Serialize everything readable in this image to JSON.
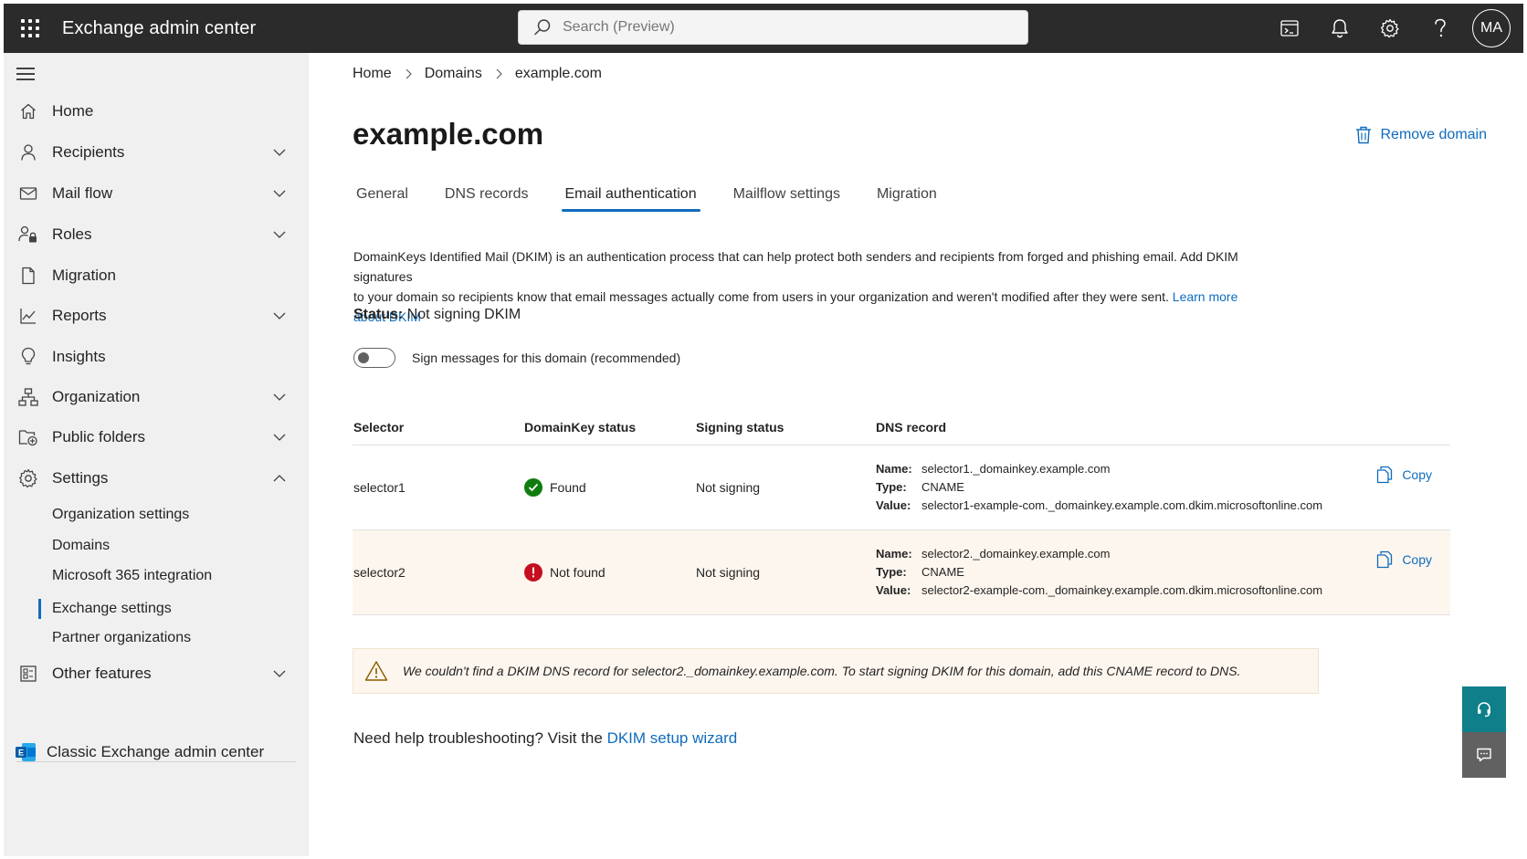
{
  "topbar": {
    "app_title": "Exchange admin center",
    "search_placeholder": "Search (Preview)",
    "avatar_initials": "MA"
  },
  "sidebar": {
    "items": [
      {
        "label": "Home",
        "icon": "home-icon"
      },
      {
        "label": "Recipients",
        "icon": "person-icon"
      },
      {
        "label": "Mail flow",
        "icon": "mail-icon"
      },
      {
        "label": "Roles",
        "icon": "person-lock-icon"
      },
      {
        "label": "Migration",
        "icon": "document-icon"
      },
      {
        "label": "Reports",
        "icon": "chart-line-icon"
      },
      {
        "label": "Insights",
        "icon": "lightbulb-icon"
      },
      {
        "label": "Organization",
        "icon": "org-chart-icon"
      },
      {
        "label": "Public folders",
        "icon": "folder-icon"
      },
      {
        "label": "Settings",
        "icon": "gear-icon"
      },
      {
        "label": "Other features",
        "icon": "apps-icon"
      }
    ],
    "settings_sub": [
      "Organization settings",
      "Domains",
      "Microsoft 365 integration",
      "Exchange settings",
      "Partner organizations"
    ],
    "classic_link": "Classic Exchange admin center"
  },
  "breadcrumb": [
    "Home",
    "Domains",
    "example.com"
  ],
  "page": {
    "title": "example.com",
    "remove_domain": "Remove domain",
    "tabs": [
      "General",
      "DNS records",
      "Email authentication",
      "Mailflow settings",
      "Migration"
    ],
    "description_line1": "DomainKeys Identified Mail (DKIM) is an authentication process that can help protect both senders and recipients from forged and phishing email. Add DKIM signatures",
    "description_line2": "to your domain so recipients know that email messages actually come from users in your organization and weren't modified after they were sent.",
    "learn_more": "Learn more about DKIM",
    "status_label": "Status:",
    "status_value": "Not signing DKIM",
    "toggle_label": "Sign messages for this domain (recommended)"
  },
  "table": {
    "headers": [
      "Selector",
      "DomainKey status",
      "Signing status",
      "DNS record"
    ],
    "name_key": "Name:",
    "type_key": "Type:",
    "value_key": "Value:",
    "copy_label": "Copy",
    "rows": [
      {
        "selector": "selector1",
        "domainkey_status": "Found",
        "signing_status": "Not signing",
        "name": "selector1._domainkey.example.com",
        "type": "CNAME",
        "value": "selector1-example-com._domainkey.example.com.dkim.microsoftonline.com"
      },
      {
        "selector": "selector2",
        "domainkey_status": "Not found",
        "signing_status": "Not signing",
        "name": "selector2._domainkey.example.com",
        "type": "CNAME",
        "value": "selector2-example-com._domainkey.example.com.dkim.microsoftonline.com"
      }
    ]
  },
  "warning": "We couldn't find a DKIM DNS record for selector2._domainkey.example.com. To start signing DKIM for this domain, add this CNAME record to DNS.",
  "help": {
    "text": "Need help troubleshooting? Visit the",
    "link": "DKIM setup wizard"
  },
  "colors": {
    "accent": "#0f6cbd",
    "found": "#107c10",
    "not_found": "#c50f1f",
    "warning_bg": "#fdf6ee"
  }
}
